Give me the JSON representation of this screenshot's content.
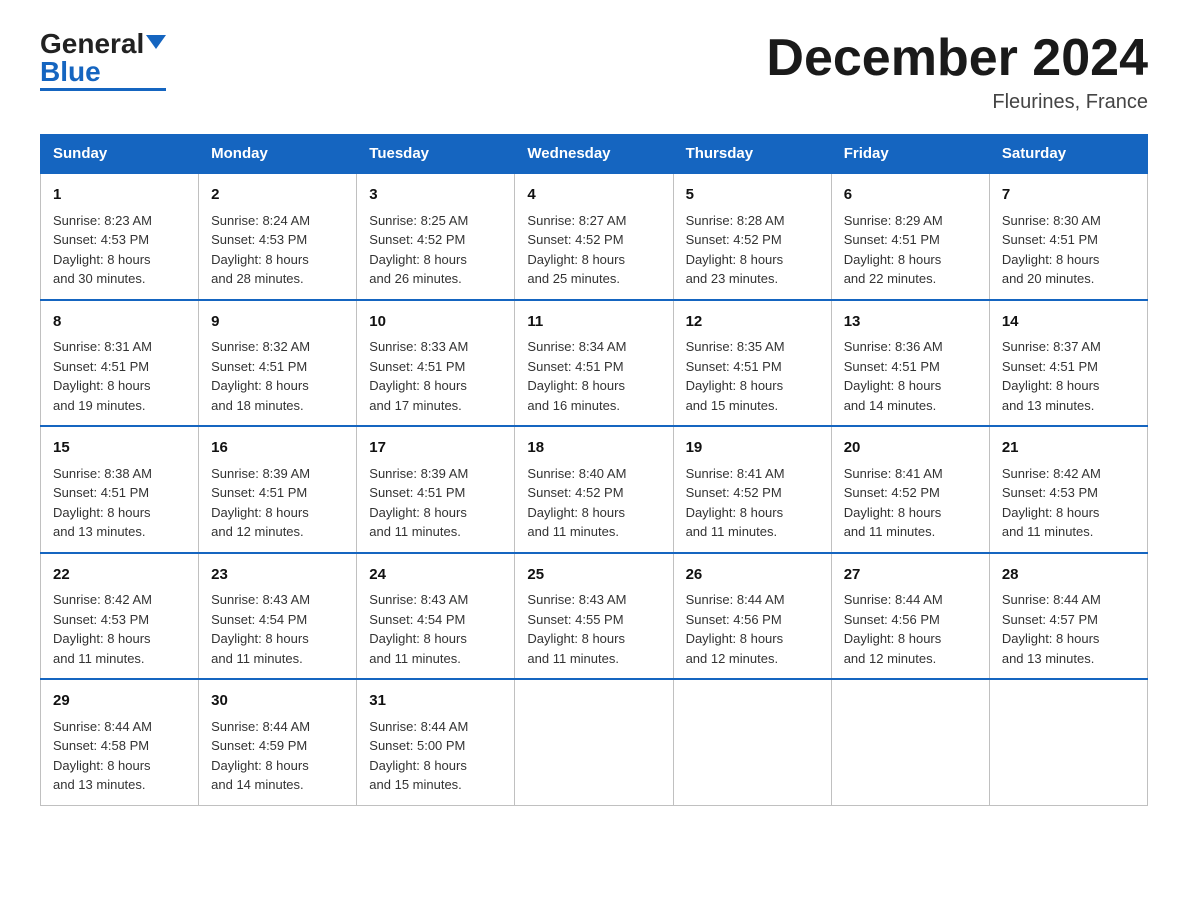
{
  "header": {
    "logo_general": "General",
    "logo_blue": "Blue",
    "month_title": "December 2024",
    "location": "Fleurines, France"
  },
  "weekdays": [
    "Sunday",
    "Monday",
    "Tuesday",
    "Wednesday",
    "Thursday",
    "Friday",
    "Saturday"
  ],
  "weeks": [
    [
      {
        "day": "1",
        "sunrise": "8:23 AM",
        "sunset": "4:53 PM",
        "daylight": "8 hours and 30 minutes."
      },
      {
        "day": "2",
        "sunrise": "8:24 AM",
        "sunset": "4:53 PM",
        "daylight": "8 hours and 28 minutes."
      },
      {
        "day": "3",
        "sunrise": "8:25 AM",
        "sunset": "4:52 PM",
        "daylight": "8 hours and 26 minutes."
      },
      {
        "day": "4",
        "sunrise": "8:27 AM",
        "sunset": "4:52 PM",
        "daylight": "8 hours and 25 minutes."
      },
      {
        "day": "5",
        "sunrise": "8:28 AM",
        "sunset": "4:52 PM",
        "daylight": "8 hours and 23 minutes."
      },
      {
        "day": "6",
        "sunrise": "8:29 AM",
        "sunset": "4:51 PM",
        "daylight": "8 hours and 22 minutes."
      },
      {
        "day": "7",
        "sunrise": "8:30 AM",
        "sunset": "4:51 PM",
        "daylight": "8 hours and 20 minutes."
      }
    ],
    [
      {
        "day": "8",
        "sunrise": "8:31 AM",
        "sunset": "4:51 PM",
        "daylight": "8 hours and 19 minutes."
      },
      {
        "day": "9",
        "sunrise": "8:32 AM",
        "sunset": "4:51 PM",
        "daylight": "8 hours and 18 minutes."
      },
      {
        "day": "10",
        "sunrise": "8:33 AM",
        "sunset": "4:51 PM",
        "daylight": "8 hours and 17 minutes."
      },
      {
        "day": "11",
        "sunrise": "8:34 AM",
        "sunset": "4:51 PM",
        "daylight": "8 hours and 16 minutes."
      },
      {
        "day": "12",
        "sunrise": "8:35 AM",
        "sunset": "4:51 PM",
        "daylight": "8 hours and 15 minutes."
      },
      {
        "day": "13",
        "sunrise": "8:36 AM",
        "sunset": "4:51 PM",
        "daylight": "8 hours and 14 minutes."
      },
      {
        "day": "14",
        "sunrise": "8:37 AM",
        "sunset": "4:51 PM",
        "daylight": "8 hours and 13 minutes."
      }
    ],
    [
      {
        "day": "15",
        "sunrise": "8:38 AM",
        "sunset": "4:51 PM",
        "daylight": "8 hours and 13 minutes."
      },
      {
        "day": "16",
        "sunrise": "8:39 AM",
        "sunset": "4:51 PM",
        "daylight": "8 hours and 12 minutes."
      },
      {
        "day": "17",
        "sunrise": "8:39 AM",
        "sunset": "4:51 PM",
        "daylight": "8 hours and 11 minutes."
      },
      {
        "day": "18",
        "sunrise": "8:40 AM",
        "sunset": "4:52 PM",
        "daylight": "8 hours and 11 minutes."
      },
      {
        "day": "19",
        "sunrise": "8:41 AM",
        "sunset": "4:52 PM",
        "daylight": "8 hours and 11 minutes."
      },
      {
        "day": "20",
        "sunrise": "8:41 AM",
        "sunset": "4:52 PM",
        "daylight": "8 hours and 11 minutes."
      },
      {
        "day": "21",
        "sunrise": "8:42 AM",
        "sunset": "4:53 PM",
        "daylight": "8 hours and 11 minutes."
      }
    ],
    [
      {
        "day": "22",
        "sunrise": "8:42 AM",
        "sunset": "4:53 PM",
        "daylight": "8 hours and 11 minutes."
      },
      {
        "day": "23",
        "sunrise": "8:43 AM",
        "sunset": "4:54 PM",
        "daylight": "8 hours and 11 minutes."
      },
      {
        "day": "24",
        "sunrise": "8:43 AM",
        "sunset": "4:54 PM",
        "daylight": "8 hours and 11 minutes."
      },
      {
        "day": "25",
        "sunrise": "8:43 AM",
        "sunset": "4:55 PM",
        "daylight": "8 hours and 11 minutes."
      },
      {
        "day": "26",
        "sunrise": "8:44 AM",
        "sunset": "4:56 PM",
        "daylight": "8 hours and 12 minutes."
      },
      {
        "day": "27",
        "sunrise": "8:44 AM",
        "sunset": "4:56 PM",
        "daylight": "8 hours and 12 minutes."
      },
      {
        "day": "28",
        "sunrise": "8:44 AM",
        "sunset": "4:57 PM",
        "daylight": "8 hours and 13 minutes."
      }
    ],
    [
      {
        "day": "29",
        "sunrise": "8:44 AM",
        "sunset": "4:58 PM",
        "daylight": "8 hours and 13 minutes."
      },
      {
        "day": "30",
        "sunrise": "8:44 AM",
        "sunset": "4:59 PM",
        "daylight": "8 hours and 14 minutes."
      },
      {
        "day": "31",
        "sunrise": "8:44 AM",
        "sunset": "5:00 PM",
        "daylight": "8 hours and 15 minutes."
      },
      null,
      null,
      null,
      null
    ]
  ],
  "labels": {
    "sunrise": "Sunrise:",
    "sunset": "Sunset:",
    "daylight": "Daylight:"
  }
}
